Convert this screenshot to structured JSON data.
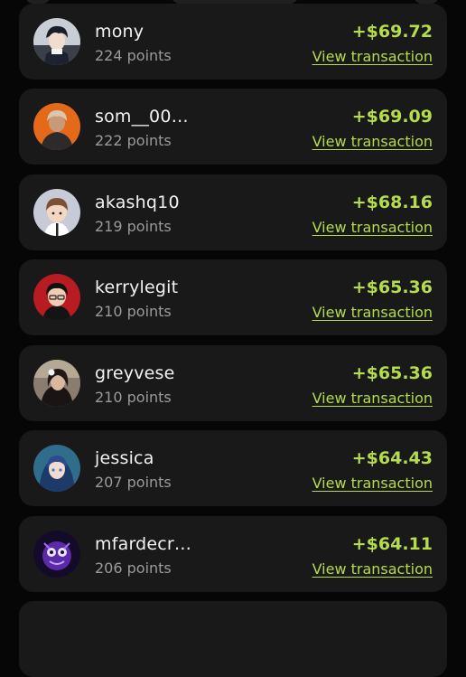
{
  "leaderboard": {
    "view_label": "View transaction",
    "entries": [
      {
        "name": "mony",
        "points": "224 points",
        "amount": "+$69.72",
        "avatar": "anime-boy-avatar"
      },
      {
        "name": "som__00…",
        "points": "222 points",
        "amount": "+$69.09",
        "avatar": "anime-figure-orange-avatar"
      },
      {
        "name": "akashq10",
        "points": "219 points",
        "amount": "+$68.16",
        "avatar": "cartoon-boy-avatar"
      },
      {
        "name": "kerrylegit",
        "points": "210 points",
        "amount": "+$65.36",
        "avatar": "red-ninja-avatar"
      },
      {
        "name": "greyvese",
        "points": "210 points",
        "amount": "+$65.36",
        "avatar": "girl-photo-avatar"
      },
      {
        "name": "jessica",
        "points": "207 points",
        "amount": "+$64.43",
        "avatar": "anime-girl-avatar"
      },
      {
        "name": "mfardecr…",
        "points": "206 points",
        "amount": "+$64.11",
        "avatar": "purple-creature-avatar"
      }
    ]
  },
  "colors": {
    "background": "#060606",
    "card": "#191919",
    "accent": "#b4dc4c",
    "name_text": "#f2f2f2",
    "secondary_text": "#9b9b9b"
  }
}
